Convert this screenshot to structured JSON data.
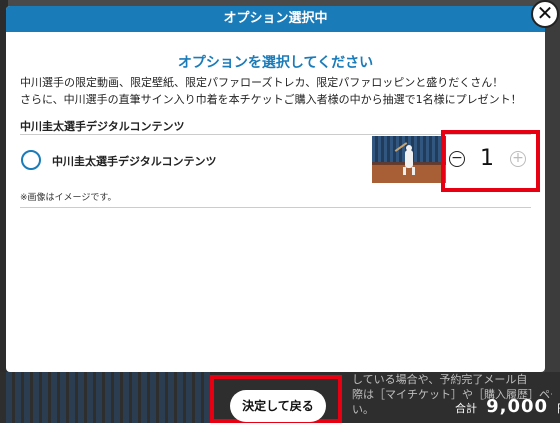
{
  "modal": {
    "header_title": "オプション選択中",
    "close_symbol": "✕",
    "title": "オプションを選択してください",
    "description_lines": [
      "中川選手の限定動画、限定壁紙、限定パファローズトレカ、限定パファロッピンと盛りだくさん！",
      "さらに、中川選手の直筆サイン入り巾着を本チケットご購入者様の中から抽選で1名様にプレゼント！"
    ],
    "section_title": "中川圭太選手デジタルコンテンツ",
    "item": {
      "name": "中川圭太選手デジタルコンテンツ",
      "quantity": "1",
      "minus_symbol": "−",
      "plus_symbol": "+"
    },
    "note": "※画像はイメージです。"
  },
  "background": {
    "notice_lines": [
      "している場合や、予約完了メール自",
      "際は［マイチケット］や［購入履歴］ページより",
      "い。"
    ]
  },
  "footer": {
    "total_label": "合計",
    "total_amount": "9,000",
    "total_unit": "円",
    "confirm_button": "決定して戻る"
  },
  "colors": {
    "accent": "#1a7bb9",
    "highlight": "#e60012"
  }
}
